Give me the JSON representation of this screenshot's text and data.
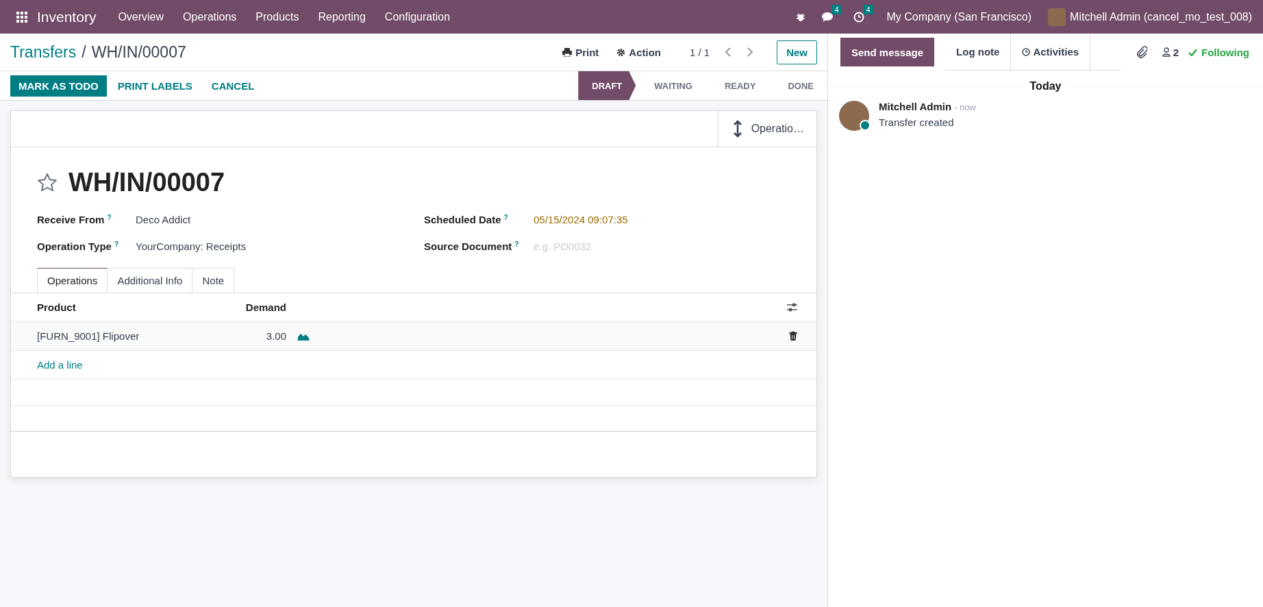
{
  "navbar": {
    "app": "Inventory",
    "menu": [
      "Overview",
      "Operations",
      "Products",
      "Reporting",
      "Configuration"
    ],
    "messages_count": "4",
    "activities_count": "4",
    "company": "My Company (San Francisco)",
    "user": "Mitchell Admin (cancel_mo_test_008)"
  },
  "breadcrumb": {
    "parent": "Transfers",
    "separator": "/",
    "current": "WH/IN/00007"
  },
  "toolbar": {
    "print": "Print",
    "action": "Action",
    "pager": "1 / 1",
    "new": "New"
  },
  "actions": [
    {
      "label": "MARK AS TODO",
      "kind": "primary"
    },
    {
      "label": "PRINT LABELS",
      "kind": "secondary"
    },
    {
      "label": "CANCEL",
      "kind": "secondary"
    }
  ],
  "status_steps": [
    {
      "label": "DRAFT",
      "selected": true
    },
    {
      "label": "WAITING",
      "selected": false
    },
    {
      "label": "READY",
      "selected": false
    },
    {
      "label": "DONE",
      "selected": false
    }
  ],
  "smart_button": "Operatio…",
  "record": {
    "title": "WH/IN/00007",
    "starred": false,
    "fields_left": [
      {
        "label": "Receive From",
        "help": "?",
        "value": "Deco Addict"
      },
      {
        "label": "Operation Type",
        "help": "?",
        "value": "YourCompany: Receipts"
      }
    ],
    "fields_right": [
      {
        "label": "Scheduled Date",
        "help": "?",
        "value": "05/15/2024 09:07:35",
        "kind": "date"
      },
      {
        "label": "Source Document",
        "help": "?",
        "placeholder": "e.g. PO0032",
        "kind": "input"
      }
    ]
  },
  "tabs": [
    {
      "label": "Operations",
      "selected": true
    },
    {
      "label": "Additional Info",
      "selected": false
    },
    {
      "label": "Note",
      "selected": false
    }
  ],
  "table": {
    "columns": [
      "Product",
      "Demand"
    ],
    "rows": [
      {
        "product": "[FURN_9001] Flipover",
        "demand": "3.00"
      }
    ],
    "add_line": "Add a line"
  },
  "chatter": {
    "buttons": [
      {
        "label": "Send message",
        "selected": true
      },
      {
        "label": "Log note",
        "selected": false
      },
      {
        "label": "Activities",
        "selected": false
      }
    ],
    "followers": "2",
    "following": "Following",
    "day": "Today",
    "messages": [
      {
        "author": "Mitchell Admin",
        "time": "- now",
        "body": "Transfer created",
        "online": true
      }
    ]
  }
}
